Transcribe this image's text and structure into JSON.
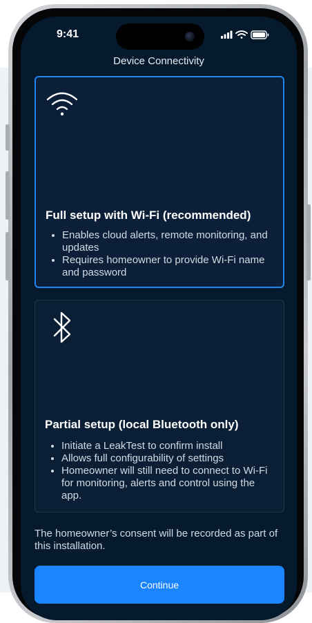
{
  "status_bar": {
    "time": "9:41",
    "icons": [
      "cellular-signal-icon",
      "wifi-icon",
      "battery-icon"
    ]
  },
  "screen": {
    "title": "Device Connectivity"
  },
  "options": [
    {
      "icon": "wifi-icon",
      "title": "Full setup with Wi-Fi (recommended)",
      "selected": true,
      "bullets": [
        "Enables cloud alerts, remote monitoring, and updates",
        "Requires homeowner to provide Wi-Fi name and password"
      ]
    },
    {
      "icon": "bluetooth-icon",
      "title": "Partial setup (local Bluetooth only)",
      "selected": false,
      "bullets": [
        "Initiate a LeakTest to confirm install",
        "Allows full configurability of settings",
        "Homeowner will still need to connect to Wi-Fi for monitoring, alerts and control using the app."
      ]
    }
  ],
  "consent_text": "The homeowner’s consent will be recorded as part of this installation.",
  "continue_label": "Continue",
  "colors": {
    "screen_background": "#061a2e",
    "selected_border": "#1e86f0",
    "primary_button": "#1a85ff"
  }
}
